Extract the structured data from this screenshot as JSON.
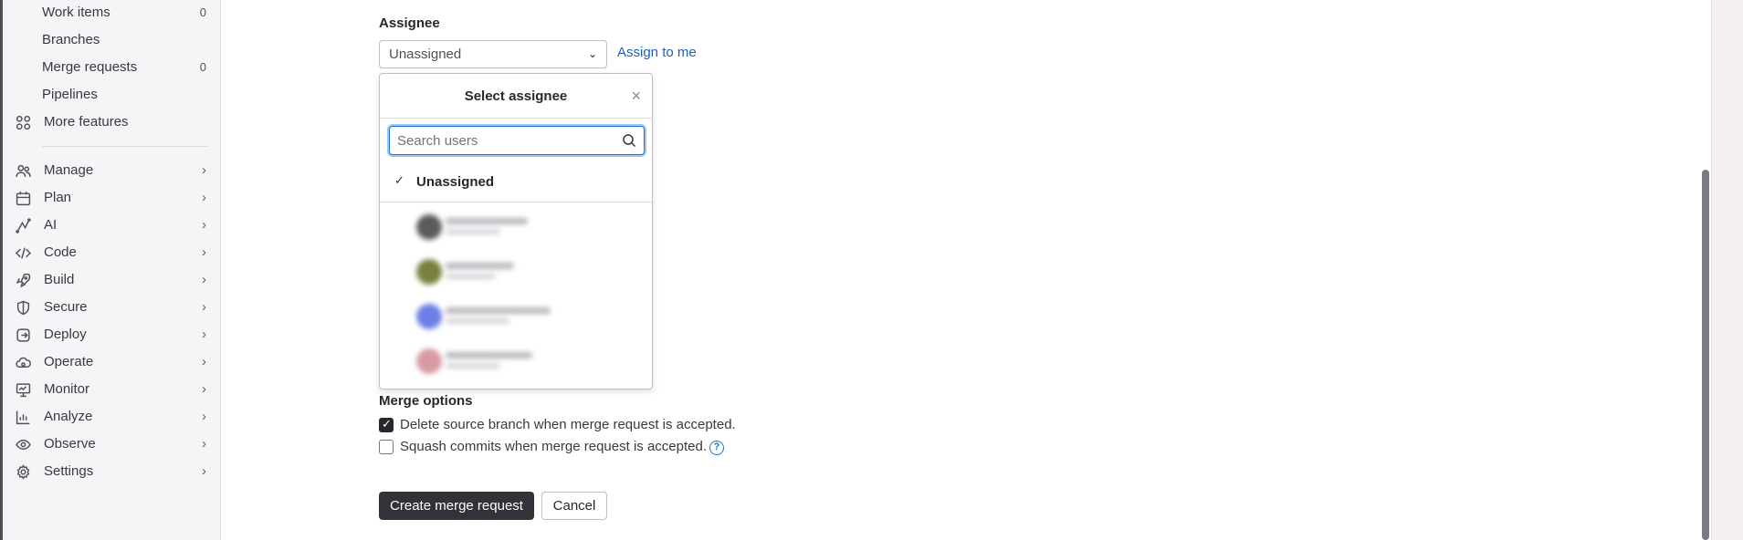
{
  "sidebar": {
    "sub_items": [
      {
        "label": "Work items",
        "count": "0"
      },
      {
        "label": "Branches",
        "count": ""
      },
      {
        "label": "Merge requests",
        "count": "0"
      },
      {
        "label": "Pipelines",
        "count": ""
      }
    ],
    "more_features": {
      "label": "More features",
      "icon": "grid-icon"
    },
    "sections": [
      {
        "label": "Manage",
        "icon": "users-icon",
        "chevron": "›"
      },
      {
        "label": "Plan",
        "icon": "calendar-icon",
        "chevron": "›"
      },
      {
        "label": "AI",
        "icon": "ai-icon",
        "chevron": "›"
      },
      {
        "label": "Code",
        "icon": "code-icon",
        "chevron": "›"
      },
      {
        "label": "Build",
        "icon": "rocket-icon",
        "chevron": "›"
      },
      {
        "label": "Secure",
        "icon": "shield-icon",
        "chevron": "›"
      },
      {
        "label": "Deploy",
        "icon": "deploy-icon",
        "chevron": "›"
      },
      {
        "label": "Operate",
        "icon": "cloud-icon",
        "chevron": "›"
      },
      {
        "label": "Monitor",
        "icon": "monitor-icon",
        "chevron": "›"
      },
      {
        "label": "Analyze",
        "icon": "chart-icon",
        "chevron": "›"
      },
      {
        "label": "Observe",
        "icon": "eye-icon",
        "chevron": "›"
      },
      {
        "label": "Settings",
        "icon": "gear-icon",
        "chevron": "›"
      }
    ]
  },
  "assignee": {
    "label": "Assignee",
    "selected": "Unassigned",
    "caret": "⌄",
    "assign_me": "Assign to me"
  },
  "dropdown": {
    "title": "Select assignee",
    "close": "×",
    "search_placeholder": "Search users",
    "search_value": "",
    "option_label": "Unassigned",
    "option_check": "✓",
    "users": [
      {
        "avatar_color": "#5b5b5b"
      },
      {
        "avatar_color": "#7a8040"
      },
      {
        "avatar_color": "#6d7fe6"
      },
      {
        "avatar_color": "#d89aa2"
      }
    ]
  },
  "merge_options": {
    "label": "Merge options",
    "options": [
      {
        "label": "Delete source branch when merge request is accepted.",
        "checked": true
      },
      {
        "label": "Squash commits when merge request is accepted.",
        "checked": false
      }
    ],
    "help": "?"
  },
  "buttons": {
    "create": "Create merge request",
    "cancel": "Cancel"
  }
}
